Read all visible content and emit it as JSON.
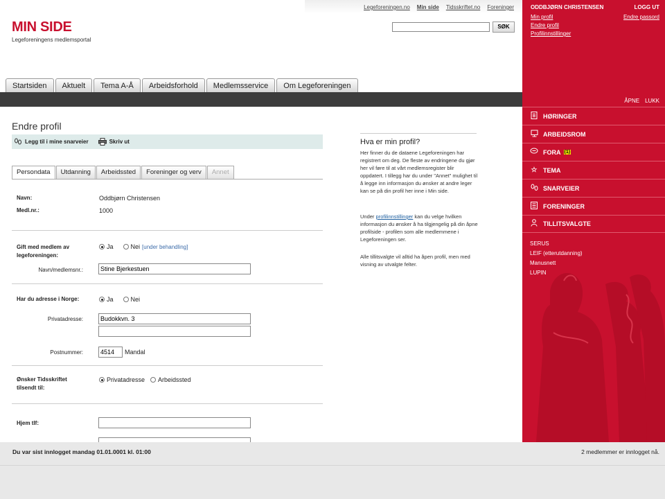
{
  "header": {
    "logo_title": "MIN SIDE",
    "logo_subtitle": "Legeforeningens medlemsportal",
    "top_links": [
      "Legeforeningen.no",
      "Min side",
      "Tidsskriftet.no",
      "Foreninger"
    ],
    "search_button": "SØK",
    "search_value": ""
  },
  "nav_tabs": [
    "Startsiden",
    "Aktuelt",
    "Tema A-Å",
    "Arbeidsforhold",
    "Medlemsservice",
    "Om Legeforeningen"
  ],
  "page": {
    "title": "Endre profil",
    "toolbar": {
      "shortcut": "Legg til i mine snarveier",
      "print": "Skriv ut"
    },
    "form_tabs": [
      "Persondata",
      "Utdanning",
      "Arbeidssted",
      "Foreninger og verv",
      "Annet"
    ]
  },
  "form": {
    "name_label": "Navn:",
    "name_value": "Oddbjørn Christensen",
    "member_label": "Medl.nr.:",
    "member_value": "1000",
    "married_label_1": "Gift med medlem av",
    "married_label_2": "legeforeningen:",
    "yes": "Ja",
    "no": "Nei",
    "pending": "[under behandling]",
    "spouse_label": "Navn/medlemsnr.:",
    "spouse_value": "Stine Bjerkestuen",
    "norway_label": "Har du adresse i Norge:",
    "address_label": "Privatadresse:",
    "address_1": "Budokkvn. 3",
    "address_2": "",
    "postal_label": "Postnummer:",
    "postal_value": "4514",
    "city": "Mandal",
    "journal_label_1": "Ønsker Tidsskriftet",
    "journal_label_2": "tilsendt til:",
    "journal_opt_1": "Privatadresse",
    "journal_opt_2": "Arbeidssted",
    "home_phone_label": "Hjem tlf:",
    "home_phone_value": "",
    "mobile_value": ""
  },
  "info": {
    "title": "Hva er min profil?",
    "p1": "Her finner du de dataene Legeforeningen har registrert om deg. De fleste av endringene du gjør her vil føre til at vårt medlemsregister blir oppdatert. I tillegg har du under \"Annet\" mulighet til å legge inn informasjon du ønsker at andre leger kan se på din profil her inne i Min side.",
    "p2_pre": "Under",
    "p2_link": "profilinnstillinger",
    "p2_post": "kan du velge hvilken informasjon du ønsker å ha tilgjengelig på din åpne profilside - profilen som alle medlemmene i Legeforeningen ser.",
    "p3": "Alle tillitsvalgte vil alltid ha åpen profil, men med visning av utvalgte felter."
  },
  "sidebar": {
    "user_name": "ODDBJØRN CHRISTENSEN",
    "logout": "LOGG UT",
    "links": [
      "Min profil",
      "Endre profil",
      "Profilinnstillinger"
    ],
    "change_password": "Endre passord",
    "open": "ÅPNE",
    "close": "LUKK",
    "menu": [
      {
        "label": "HØRINGER",
        "icon": "document-icon"
      },
      {
        "label": "ARBEIDSROM",
        "icon": "monitor-icon"
      },
      {
        "label": "FORA",
        "icon": "chat-icon",
        "badge": "(1)"
      },
      {
        "label": "TEMA",
        "icon": "star-icon"
      },
      {
        "label": "SNARVEIER",
        "icon": "footprints-icon"
      },
      {
        "label": "FORENINGER",
        "icon": "list-icon"
      },
      {
        "label": "TILLITSVALGTE",
        "icon": "person-icon"
      }
    ],
    "sub_links": [
      "SERUS",
      "LEIF (etterutdanning)",
      "Manusnett",
      "LUPIN"
    ]
  },
  "footer": {
    "last_login": "Du var sist innlogget mandag 01.01.0001 kl. 01:00",
    "online": "2 medlemmer er innlogget nå."
  },
  "colors": {
    "brand_red": "#c8102e",
    "toolbar_bg": "#deebea",
    "dark_bar": "#3c3c3c"
  }
}
